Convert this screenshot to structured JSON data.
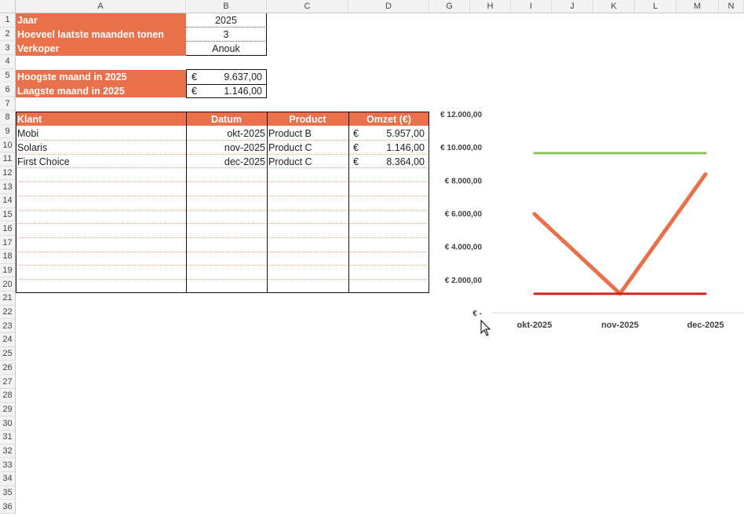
{
  "columns": [
    "A",
    "B",
    "C",
    "D",
    "G",
    "H",
    "I",
    "J",
    "K",
    "L",
    "M",
    "N"
  ],
  "rows": [
    "1",
    "2",
    "3",
    "4",
    "5",
    "6",
    "7",
    "8",
    "9",
    "10",
    "11",
    "12",
    "13",
    "14",
    "15",
    "16",
    "17",
    "18",
    "19",
    "20",
    "21",
    "22",
    "23",
    "24",
    "25",
    "26",
    "27",
    "28",
    "29",
    "30",
    "31",
    "32",
    "33",
    "34",
    "35",
    "36"
  ],
  "params": {
    "jaar_label": "Jaar",
    "jaar_value": "2025",
    "maanden_label": "Hoeveel laatste maanden tonen",
    "maanden_value": "3",
    "verkoper_label": "Verkoper",
    "verkoper_value": "Anouk"
  },
  "summary": {
    "hoogste_label": "Hoogste maand in 2025",
    "hoogste_currency": "€",
    "hoogste_value": "9.637,00",
    "laagste_label": "Laagste maand in 2025",
    "laagste_currency": "€",
    "laagste_value": "1.146,00"
  },
  "table": {
    "headers": [
      "Klant",
      "Datum",
      "Product",
      "Omzet (€)"
    ],
    "rows": [
      {
        "klant": "Mobi",
        "datum": "okt-2025",
        "product": "Product B",
        "currency": "€",
        "omzet": "5.957,00"
      },
      {
        "klant": "Solaris",
        "datum": "nov-2025",
        "product": "Product C",
        "currency": "€",
        "omzet": "1.146,00"
      },
      {
        "klant": "First Choice",
        "datum": "dec-2025",
        "product": "Product C",
        "currency": "€",
        "omzet": "8.364,00"
      }
    ]
  },
  "chart_data": {
    "type": "line",
    "categories": [
      "okt-2025",
      "nov-2025",
      "dec-2025"
    ],
    "series": [
      {
        "values": [
          5957,
          1146,
          8364
        ],
        "color": "#e8704a"
      },
      {
        "values": [
          9637,
          9637,
          9637
        ],
        "color": "#8dc45a"
      },
      {
        "values": [
          1146,
          1146,
          1146
        ],
        "color": "#d9241b"
      }
    ],
    "ylim": [
      0,
      12000
    ],
    "yticks": [
      0,
      2000,
      4000,
      6000,
      8000,
      10000,
      12000
    ],
    "ytick_labels": [
      "€ -",
      "€ 2.000,00",
      "€ 4.000,00",
      "€ 6.000,00",
      "€ 8.000,00",
      "€ 10.000,00",
      "€ 12.000,00"
    ],
    "title": "",
    "xlabel": "",
    "ylabel": "",
    "grid": false,
    "legend": "none"
  }
}
